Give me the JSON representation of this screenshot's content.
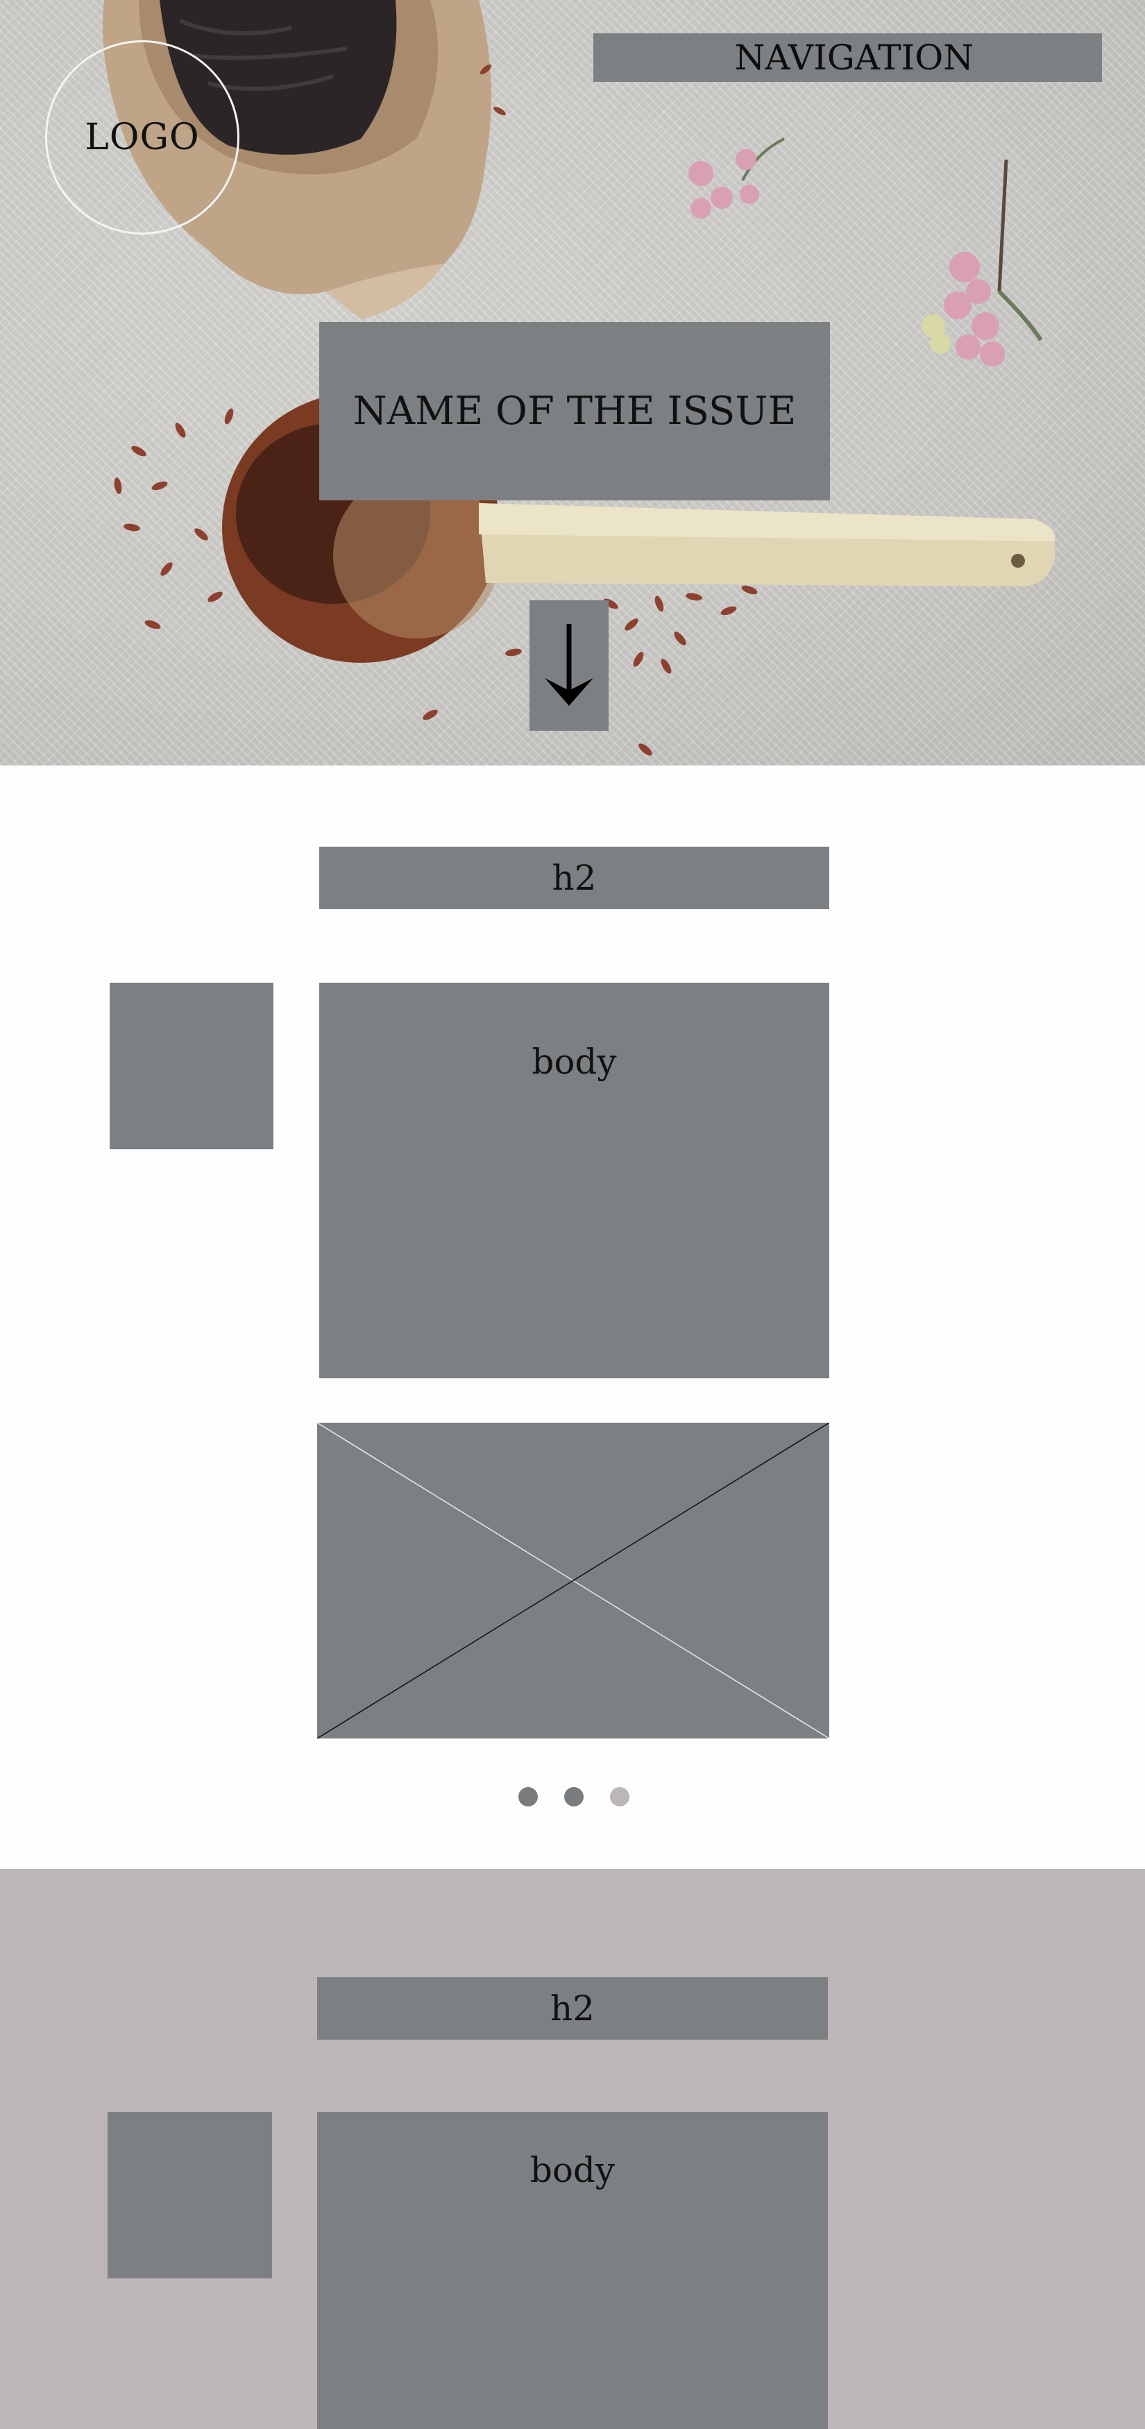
{
  "header": {
    "logo_text": "LOGO",
    "navigation_label": "NAVIGATION"
  },
  "hero": {
    "issue_title": "NAME OF THE ISSUE",
    "scroll_icon": "arrow-down-icon"
  },
  "section1": {
    "heading": "h2",
    "body": "body",
    "slider_icon": "image-placeholder-icon",
    "dots": [
      {
        "active": true,
        "color": "#797c7f"
      },
      {
        "active": true,
        "color": "#797c7f"
      },
      {
        "active": false,
        "color": "#bdb6b6"
      }
    ]
  },
  "section2": {
    "heading": "h2",
    "body": "body",
    "background": "#bdb6b6"
  },
  "colors": {
    "placeholder_gray": "#7d8083",
    "page_background": "#fdfdfd",
    "section_background": "#bdb6b6"
  }
}
